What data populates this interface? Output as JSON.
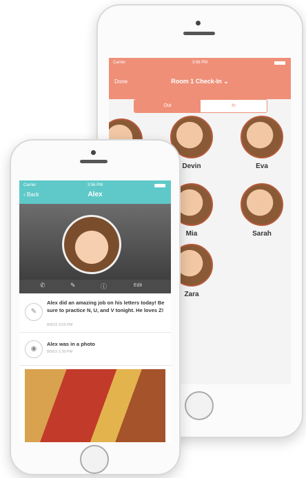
{
  "back_phone": {
    "status": {
      "carrier": "Carrier",
      "time": "3:56 PM"
    },
    "header": {
      "done": "Done",
      "title": "Room 1 Check-In ⌄"
    },
    "segment": {
      "out": "Out",
      "in": "In"
    },
    "kids": [
      {
        "name": ""
      },
      {
        "name": "Devin"
      },
      {
        "name": "Eva"
      },
      {
        "name": ""
      },
      {
        "name": "Mia"
      },
      {
        "name": "Sarah"
      },
      {
        "name": "Zara"
      }
    ]
  },
  "front_phone": {
    "status": {
      "carrier": "Carrier",
      "time": "3:56 PM"
    },
    "header": {
      "back": "‹ Back",
      "title": "Alex"
    },
    "actions": {
      "phone_icon": "phone-icon",
      "note_icon": "note-icon",
      "info_icon": "info-icon",
      "edit": "Edit"
    },
    "feed": [
      {
        "icon": "note-icon",
        "text": "Alex did an amazing job on his letters today! Be sure to practice N, U, and V tonight. He loves Z!",
        "time": "8/9/15 3:53 PM"
      },
      {
        "icon": "camera-icon",
        "text": "Alex was in a photo",
        "time": "8/9/15 1:30 PM"
      }
    ]
  },
  "colors": {
    "coral": "#ef8f78",
    "teal": "#5ec9c8"
  }
}
